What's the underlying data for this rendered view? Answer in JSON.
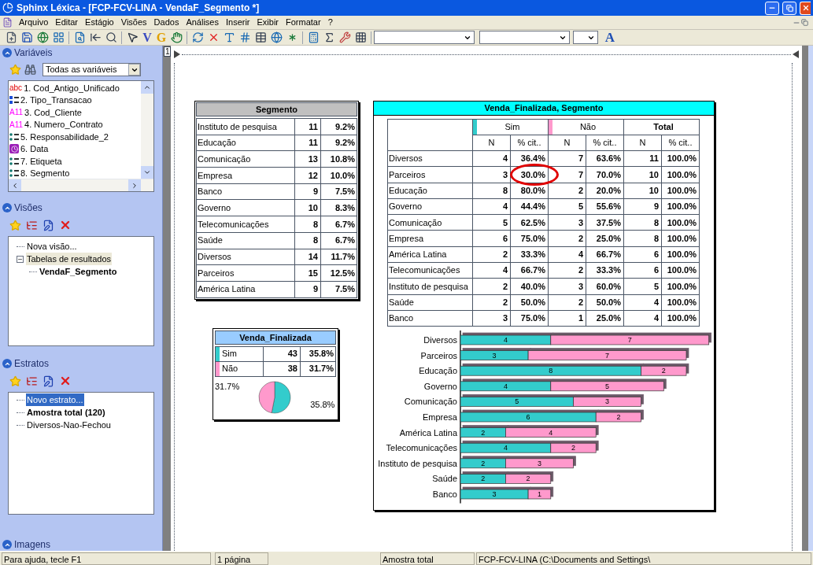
{
  "window": {
    "title": "Sphinx Léxica - [FCP-FCV-LINA - VendaF_Segmento *]"
  },
  "menu": [
    "Arquivo",
    "Editar",
    "Estágio",
    "Visões",
    "Dados",
    "Análises",
    "Inserir",
    "Exibir",
    "Formatar",
    "?"
  ],
  "toolbar": {
    "letter_buttons": [
      "V",
      "G"
    ],
    "font_button": "A"
  },
  "page_number": "1",
  "sidebar": {
    "variables": {
      "title": "Variáveis",
      "filter": "Todas as variáveis",
      "items": [
        {
          "kind": "text",
          "badge": "abc",
          "label": "1. Cod_Antigo_Unificado"
        },
        {
          "kind": "multi",
          "label": "2. Tipo_Transacao"
        },
        {
          "kind": "code",
          "badge": "A11",
          "label": "3. Cod_Cliente"
        },
        {
          "kind": "code",
          "badge": "A11",
          "label": "4. Numero_Contrato"
        },
        {
          "kind": "closed",
          "label": "5. Responsabilidade_2"
        },
        {
          "kind": "date",
          "label": "6. Data"
        },
        {
          "kind": "closed",
          "label": "7. Etiqueta"
        },
        {
          "kind": "closed",
          "label": "8. Segmento"
        }
      ]
    },
    "views": {
      "title": "Visões",
      "tree": [
        {
          "label": "Nova visão...",
          "selected": false,
          "active": false
        },
        {
          "label": "Tabelas de resultados",
          "selected": true,
          "active": false,
          "expanded": true,
          "children": [
            {
              "label": "VendaF_Segmento",
              "selected": false,
              "active": true
            }
          ]
        }
      ]
    },
    "strata": {
      "title": "Estratos",
      "tree": [
        {
          "label": "Novo estrato...",
          "selected": true,
          "active": false
        },
        {
          "label": "Amostra total (120)",
          "selected": false,
          "active": true
        },
        {
          "label": "Diversos-Nao-Fechou",
          "selected": false,
          "active": false
        }
      ]
    },
    "images": {
      "title": "Imagens"
    }
  },
  "segment_table": {
    "title": "Segmento",
    "rows": [
      [
        "Instituto de pesquisa",
        "11",
        "9.2%"
      ],
      [
        "Educação",
        "11",
        "9.2%"
      ],
      [
        "Comunicação",
        "13",
        "10.8%"
      ],
      [
        "Empresa",
        "12",
        "10.0%"
      ],
      [
        "Banco",
        "9",
        "7.5%"
      ],
      [
        "Governo",
        "10",
        "8.3%"
      ],
      [
        "Telecomunicações",
        "8",
        "6.7%"
      ],
      [
        "Saúde",
        "8",
        "6.7%"
      ],
      [
        "Diversos",
        "14",
        "11.7%"
      ],
      [
        "Parceiros",
        "15",
        "12.5%"
      ],
      [
        "América Latina",
        "9",
        "7.5%"
      ]
    ]
  },
  "summary": {
    "title": "Venda_Finalizada",
    "rows": [
      {
        "label": "Sim",
        "color": "#33cccc",
        "n": "43",
        "pct": "35.8%"
      },
      {
        "label": "Não",
        "color": "#ff99cc",
        "n": "38",
        "pct": "31.7%"
      }
    ],
    "chart_data": {
      "type": "pie",
      "series": [
        {
          "values": [
            53.1,
            46.9
          ]
        }
      ],
      "value_labels": [
        "35.8%",
        "31.7%"
      ]
    }
  },
  "crosstab": {
    "title": "Venda_Finalizada, Segmento",
    "groups": [
      {
        "label": "Sim",
        "color": "#33cccc"
      },
      {
        "label": "Não",
        "color": "#ff99cc"
      },
      {
        "label": "Total"
      }
    ],
    "subheaders": [
      "N",
      "% cit..",
      "N",
      "% cit..",
      "N",
      "% cit.."
    ],
    "rows": [
      {
        "label": "Diversos",
        "cells": [
          "4",
          "36.4%",
          "7",
          "63.6%",
          "11",
          "100.0%"
        ],
        "circled": false
      },
      {
        "label": "Parceiros",
        "cells": [
          "3",
          "30.0%",
          "7",
          "70.0%",
          "10",
          "100.0%"
        ],
        "circled": true
      },
      {
        "label": "Educação",
        "cells": [
          "8",
          "80.0%",
          "2",
          "20.0%",
          "10",
          "100.0%"
        ],
        "circled": false
      },
      {
        "label": "Governo",
        "cells": [
          "4",
          "44.4%",
          "5",
          "55.6%",
          "9",
          "100.0%"
        ],
        "circled": false
      },
      {
        "label": "Comunicação",
        "cells": [
          "5",
          "62.5%",
          "3",
          "37.5%",
          "8",
          "100.0%"
        ],
        "circled": false
      },
      {
        "label": "Empresa",
        "cells": [
          "6",
          "75.0%",
          "2",
          "25.0%",
          "8",
          "100.0%"
        ],
        "circled": false
      },
      {
        "label": "América Latina",
        "cells": [
          "2",
          "33.3%",
          "4",
          "66.7%",
          "6",
          "100.0%"
        ],
        "circled": false
      },
      {
        "label": "Telecomunicações",
        "cells": [
          "4",
          "66.7%",
          "2",
          "33.3%",
          "6",
          "100.0%"
        ],
        "circled": false
      },
      {
        "label": "Instituto de pesquisa",
        "cells": [
          "2",
          "40.0%",
          "3",
          "60.0%",
          "5",
          "100.0%"
        ],
        "circled": false
      },
      {
        "label": "Saúde",
        "cells": [
          "2",
          "50.0%",
          "2",
          "50.0%",
          "4",
          "100.0%"
        ],
        "circled": false
      },
      {
        "label": "Banco",
        "cells": [
          "3",
          "75.0%",
          "1",
          "25.0%",
          "4",
          "100.0%"
        ],
        "circled": false
      }
    ],
    "chart_data": {
      "type": "bar",
      "orientation": "horizontal",
      "stacked": true,
      "data_labels": true,
      "categories": [
        "Diversos",
        "Parceiros",
        "Educação",
        "Governo",
        "Comunicação",
        "Empresa",
        "América Latina",
        "Telecomunicações",
        "Instituto de pesquisa",
        "Saúde",
        "Banco"
      ],
      "series": [
        {
          "color": "#33cccc",
          "values": [
            4,
            3,
            8,
            4,
            5,
            6,
            2,
            4,
            2,
            2,
            3
          ]
        },
        {
          "color": "#ff99cc",
          "values": [
            7,
            7,
            2,
            5,
            3,
            2,
            4,
            2,
            3,
            2,
            1
          ]
        }
      ]
    }
  },
  "status_bar": [
    "Para ajuda, tecle F1",
    "1 página",
    "Amostra total",
    "FCP-FCV-LINA (C:\\Documents and Settings\\"
  ]
}
